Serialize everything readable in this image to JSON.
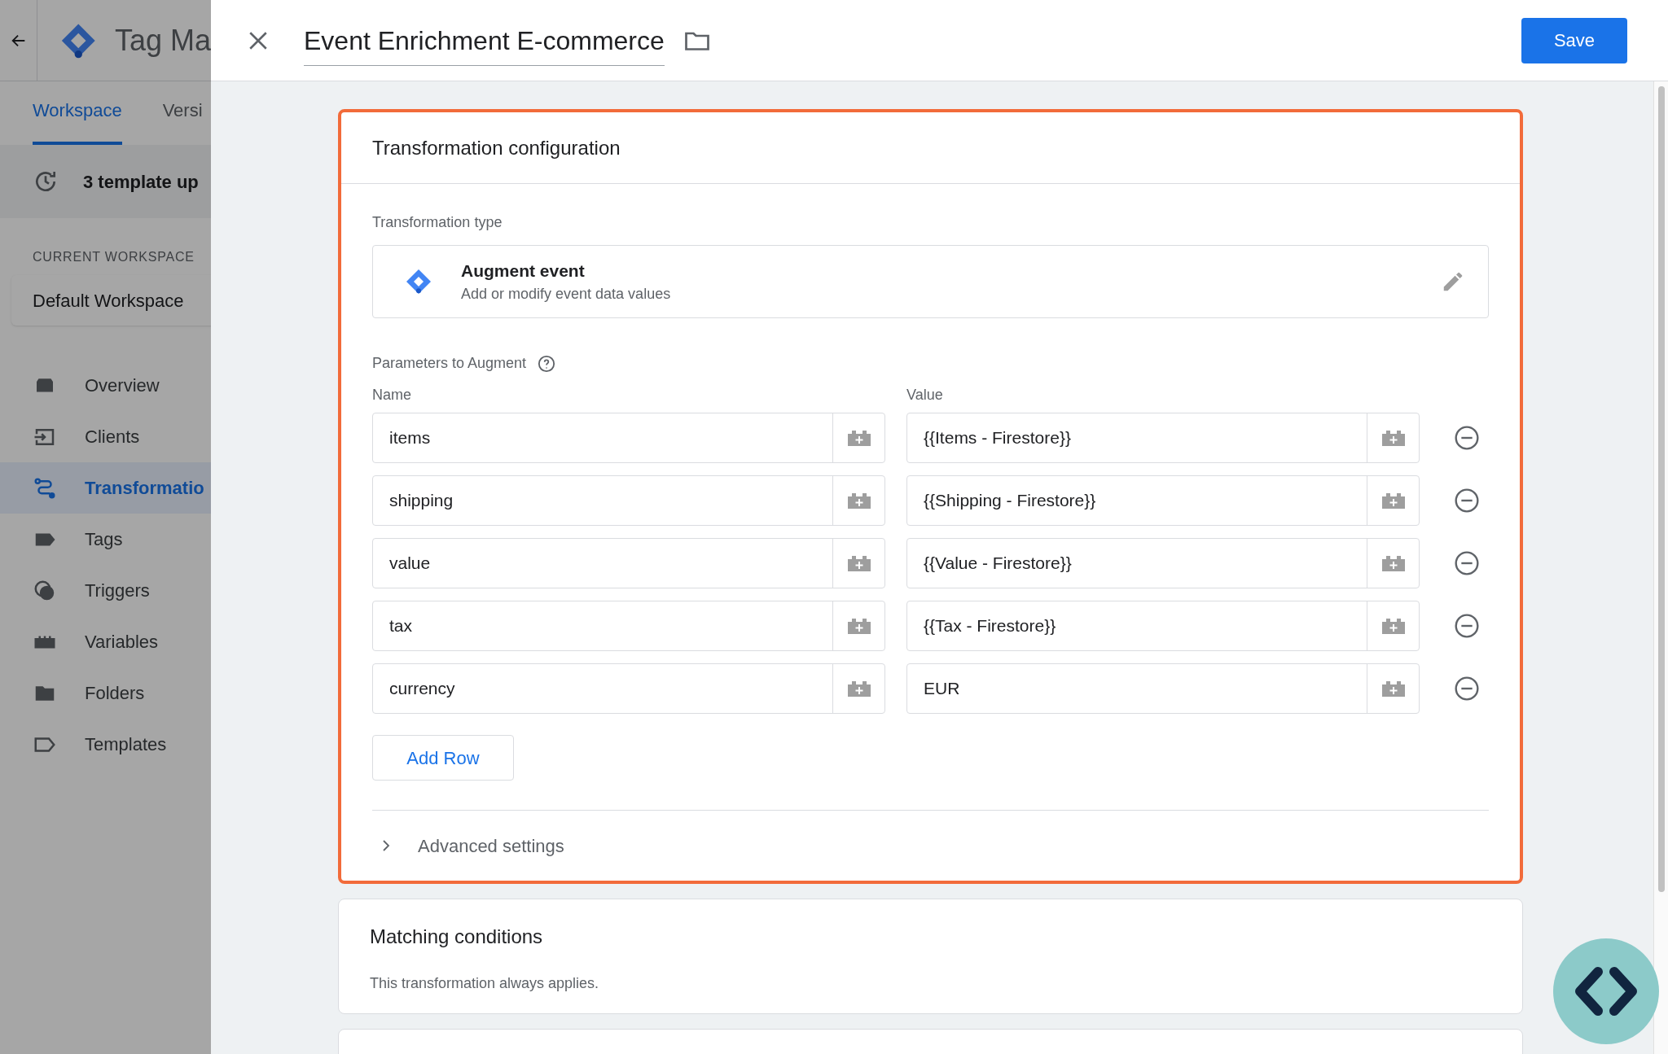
{
  "app": {
    "title": "Tag Ma"
  },
  "tabs": [
    {
      "label": "Workspace",
      "selected": true
    },
    {
      "label": "Versi",
      "selected": false
    }
  ],
  "notice": "3 template up",
  "current_workspace": {
    "heading": "CURRENT WORKSPACE",
    "name": "Default Workspace"
  },
  "sidebar": {
    "items": [
      {
        "label": "Overview",
        "kind": "overview",
        "selected": false
      },
      {
        "label": "Clients",
        "kind": "clients",
        "selected": false
      },
      {
        "label": "Transformatio",
        "kind": "transformations",
        "selected": true
      },
      {
        "label": "Tags",
        "kind": "tags",
        "selected": false
      },
      {
        "label": "Triggers",
        "kind": "triggers",
        "selected": false
      },
      {
        "label": "Variables",
        "kind": "variables",
        "selected": false
      },
      {
        "label": "Folders",
        "kind": "folders",
        "selected": false
      },
      {
        "label": "Templates",
        "kind": "templates",
        "selected": false
      }
    ]
  },
  "editor": {
    "title": "Event Enrichment E-commerce",
    "save": "Save"
  },
  "configuration": {
    "title": "Transformation configuration",
    "type_label": "Transformation type",
    "type_name": "Augment event",
    "type_description": "Add or modify event data values",
    "params_label": "Parameters to Augment",
    "name_header": "Name",
    "value_header": "Value",
    "rows": [
      {
        "name": "items",
        "value": "{{Items - Firestore}}"
      },
      {
        "name": "shipping",
        "value": "{{Shipping - Firestore}}"
      },
      {
        "name": "value",
        "value": "{{Value - Firestore}}"
      },
      {
        "name": "tax",
        "value": "{{Tax - Firestore}}"
      },
      {
        "name": "currency",
        "value": "EUR"
      }
    ],
    "add_row": "Add Row",
    "advanced": {
      "label": "Advanced settings",
      "expanded": false
    }
  },
  "matching": {
    "title": "Matching conditions",
    "text": "This transformation always applies."
  }
}
